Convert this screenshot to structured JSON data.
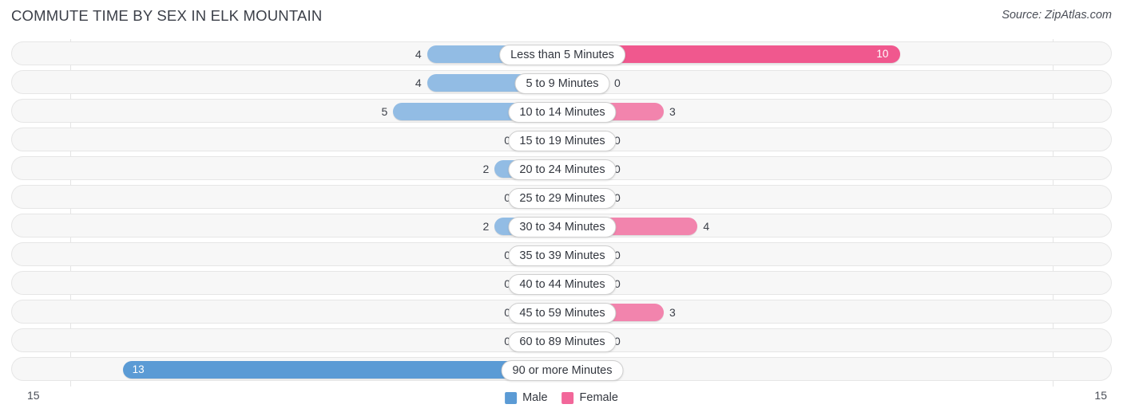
{
  "header": {
    "title": "COMMUTE TIME BY SEX IN ELK MOUNTAIN",
    "source": "Source: ZipAtlas.com"
  },
  "legend": {
    "male": "Male",
    "female": "Female",
    "male_color": "#5b9bd5",
    "female_color": "#f2679a"
  },
  "axis": {
    "left_tick": "15",
    "right_tick": "15"
  },
  "chart_data": {
    "type": "bar",
    "title": "COMMUTE TIME BY SEX IN ELK MOUNTAIN",
    "orientation": "horizontal-diverging",
    "xlabel": "",
    "ylabel": "",
    "xlim": [
      15,
      15
    ],
    "grid": false,
    "legend_position": "bottom-center",
    "categories": [
      "Less than 5 Minutes",
      "5 to 9 Minutes",
      "10 to 14 Minutes",
      "15 to 19 Minutes",
      "20 to 24 Minutes",
      "25 to 29 Minutes",
      "30 to 34 Minutes",
      "35 to 39 Minutes",
      "40 to 44 Minutes",
      "45 to 59 Minutes",
      "60 to 89 Minutes",
      "90 or more Minutes"
    ],
    "series": [
      {
        "name": "Male",
        "values": [
          4,
          4,
          5,
          0,
          2,
          0,
          2,
          0,
          0,
          0,
          0,
          13
        ]
      },
      {
        "name": "Female",
        "values": [
          10,
          0,
          3,
          0,
          0,
          0,
          4,
          0,
          0,
          3,
          0,
          0
        ]
      }
    ]
  },
  "rows": [
    {
      "label": "Less than 5 Minutes",
      "male": "4",
      "female": "10",
      "male_inside": false,
      "female_inside": true
    },
    {
      "label": "5 to 9 Minutes",
      "male": "4",
      "female": "0",
      "male_inside": false,
      "female_inside": false
    },
    {
      "label": "10 to 14 Minutes",
      "male": "5",
      "female": "3",
      "male_inside": false,
      "female_inside": false
    },
    {
      "label": "15 to 19 Minutes",
      "male": "0",
      "female": "0",
      "male_inside": false,
      "female_inside": false
    },
    {
      "label": "20 to 24 Minutes",
      "male": "2",
      "female": "0",
      "male_inside": false,
      "female_inside": false
    },
    {
      "label": "25 to 29 Minutes",
      "male": "0",
      "female": "0",
      "male_inside": false,
      "female_inside": false
    },
    {
      "label": "30 to 34 Minutes",
      "male": "2",
      "female": "4",
      "male_inside": false,
      "female_inside": false
    },
    {
      "label": "35 to 39 Minutes",
      "male": "0",
      "female": "0",
      "male_inside": false,
      "female_inside": false
    },
    {
      "label": "40 to 44 Minutes",
      "male": "0",
      "female": "0",
      "male_inside": false,
      "female_inside": false
    },
    {
      "label": "45 to 59 Minutes",
      "male": "0",
      "female": "3",
      "male_inside": false,
      "female_inside": false
    },
    {
      "label": "60 to 89 Minutes",
      "male": "0",
      "female": "0",
      "male_inside": false,
      "female_inside": false
    },
    {
      "label": "90 or more Minutes",
      "male": "13",
      "female": "0",
      "male_inside": true,
      "female_inside": false
    }
  ]
}
